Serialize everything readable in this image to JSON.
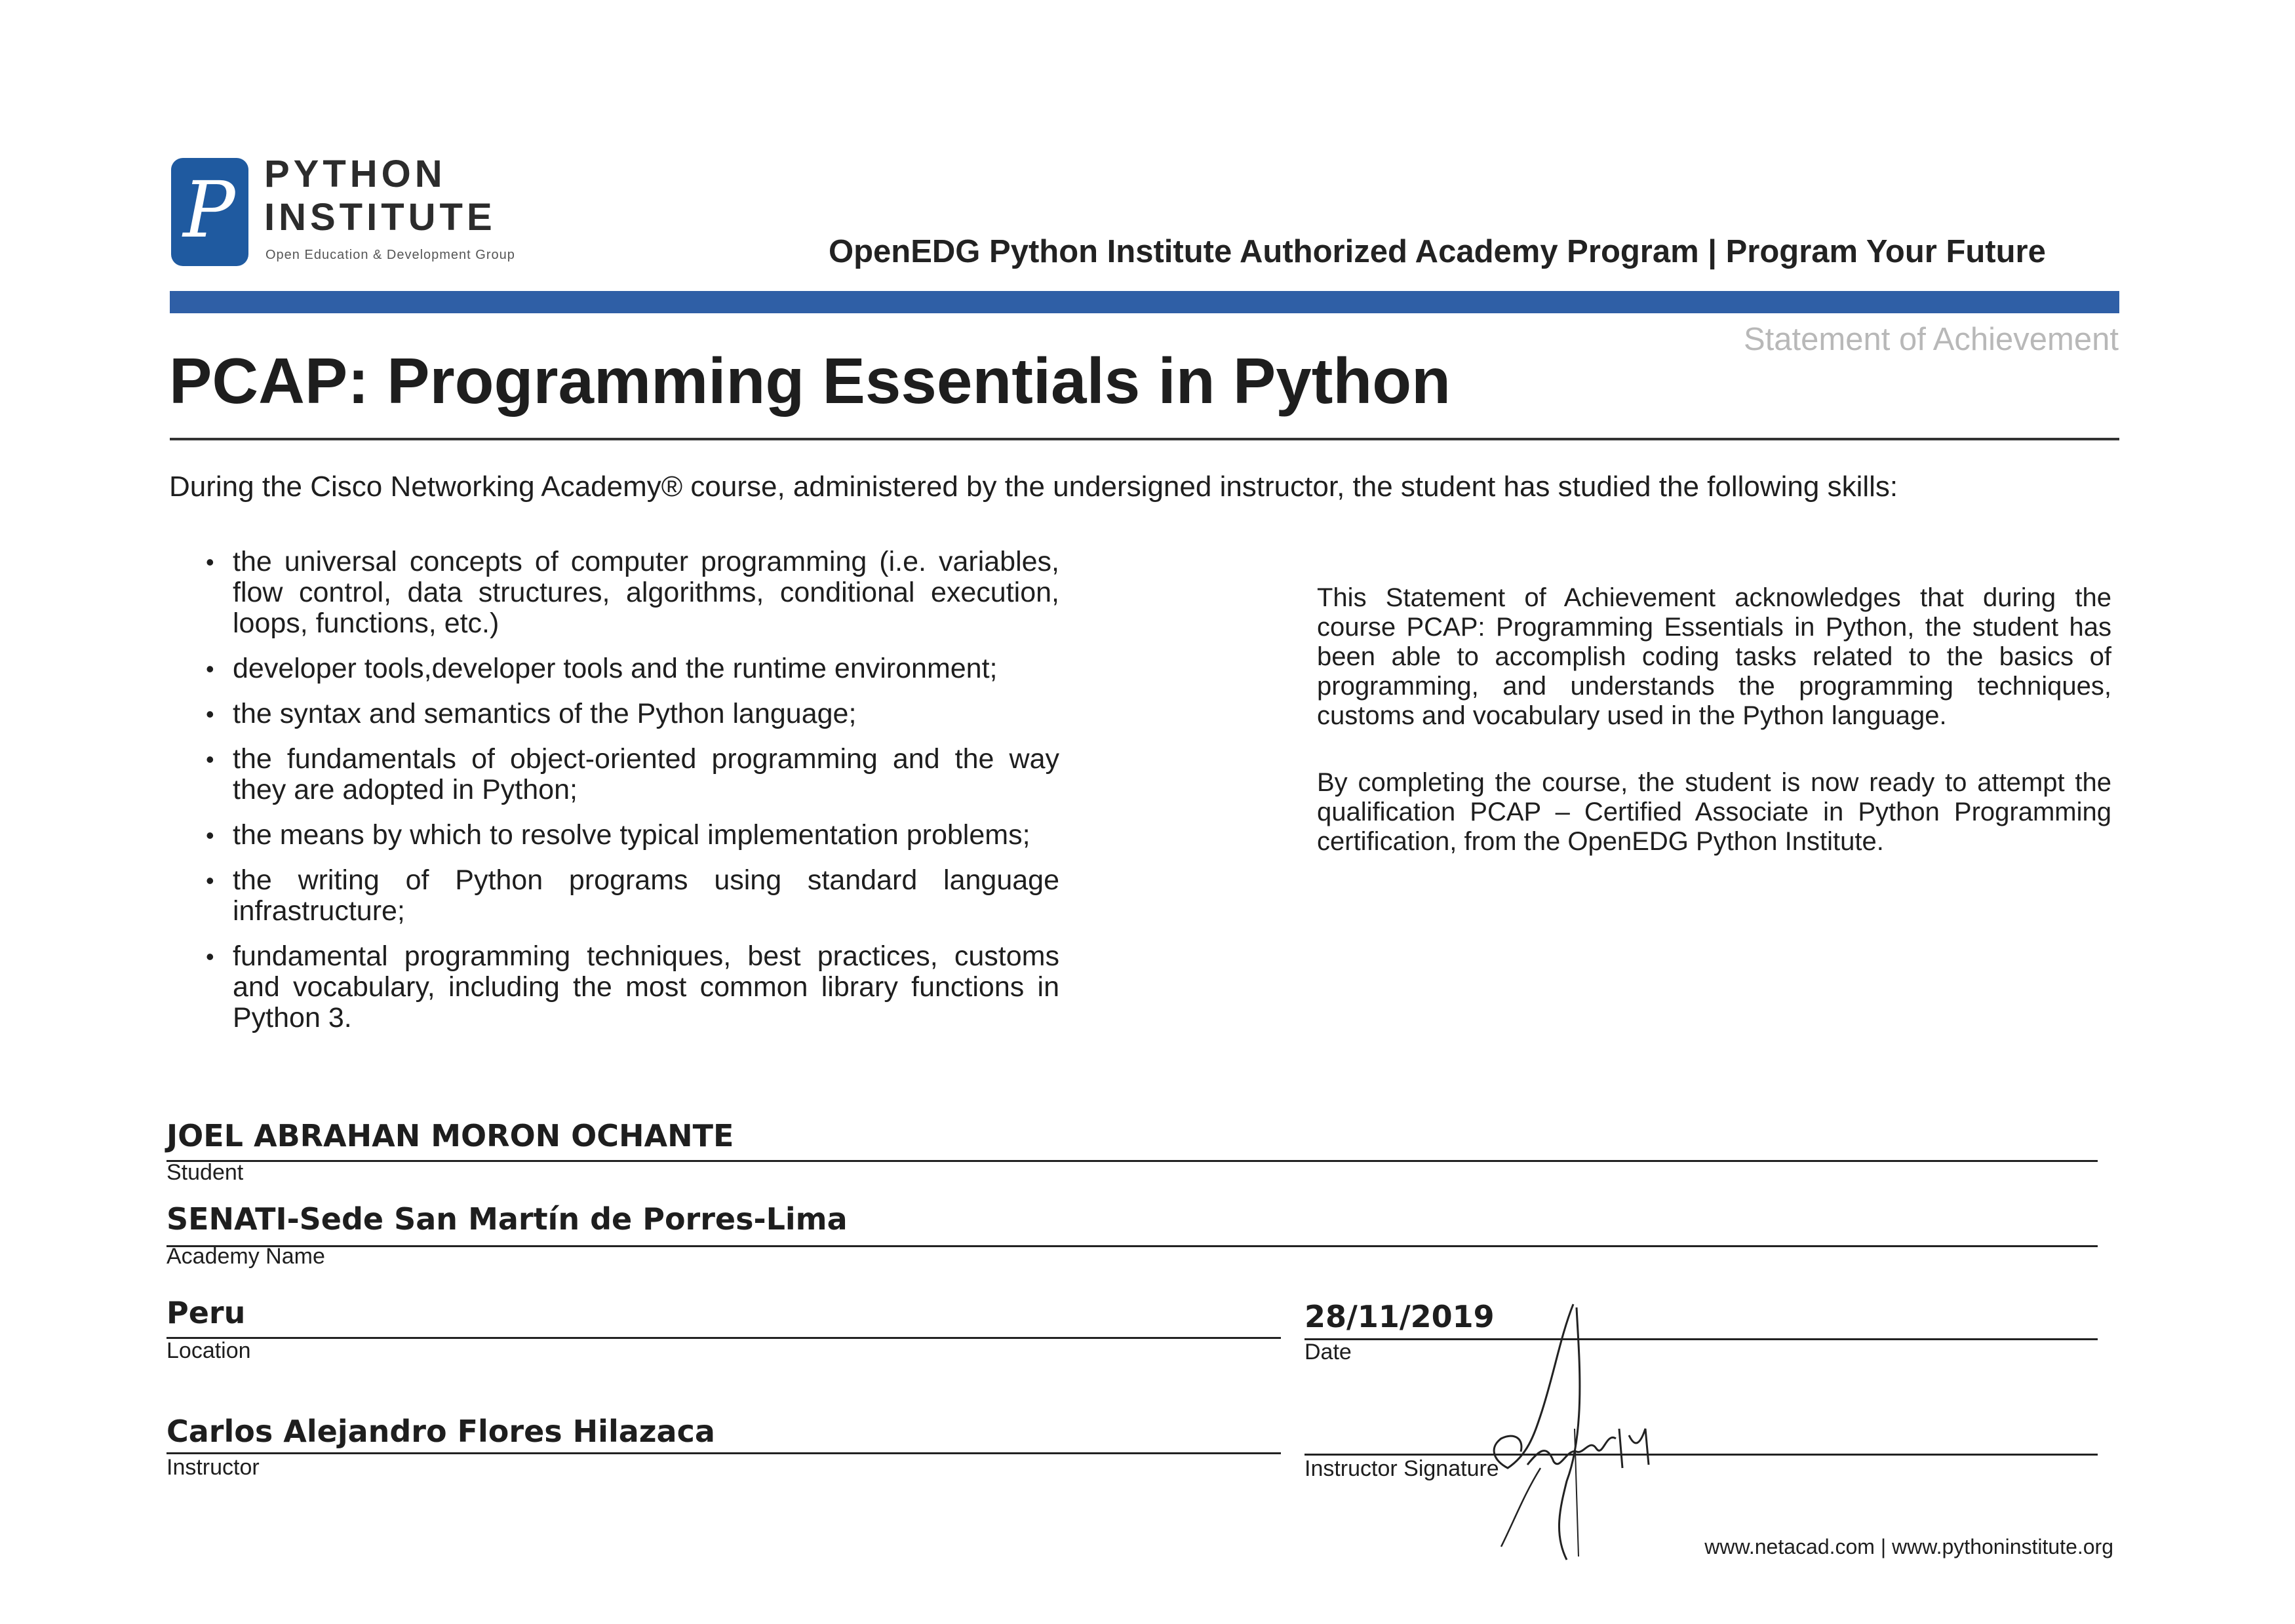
{
  "logo": {
    "name_line1": "PYTHON",
    "name_line2": "INSTITUTE",
    "tagline": "Open Education & Development Group",
    "icon": "python-institute-p-logo",
    "color": "#1f5aa0"
  },
  "program_line": "OpenEDG Python Institute Authorized Academy Program | Program Your Future",
  "statement_label": "Statement of Achievement",
  "course_title": "PCAP: Programming Essentials in Python",
  "intro": "During the Cisco Networking Academy® course, administered by the undersigned instructor, the student has studied the following skills:",
  "skills": [
    "the universal concepts of computer programming (i.e. variables, flow control, data structures, algorithms, conditional execution, loops, functions, etc.)",
    "developer tools,developer tools and the runtime environment;",
    "the syntax and semantics of the Python language;",
    "the fundamentals of object-oriented programming and the way they are adopted in Python;",
    "the means by which to resolve typical implementation problems;",
    "the writing of Python programs using standard language infrastructure;",
    "fundamental programming techniques, best practices, customs and vocabulary, including the most common library functions in Python 3."
  ],
  "achievement": {
    "paragraph1": "This Statement of Achievement acknowledges that during the course PCAP: Programming Essentials in Python, the student has been able to accomplish coding tasks related to the basics of programming, and understands the programming techniques, customs and vocabulary used in the Python language.",
    "paragraph2": "By completing the course, the student is now ready to attempt the qualification PCAP – Certified Associate in Python Programming certification, from the OpenEDG Python Institute."
  },
  "fields": {
    "student_name": "JOEL ABRAHAN MORON OCHANTE",
    "student_label": "Student",
    "academy_name": "SENATI-Sede San Martín de Porres-Lima",
    "academy_label": "Academy Name",
    "location": "Peru",
    "location_label": "Location",
    "date": "28/11/2019",
    "date_label": "Date",
    "instructor": "Carlos Alejandro Flores Hilazaca",
    "instructor_label": "Instructor",
    "signature_label": "Instructor Signature"
  },
  "footer": "www.netacad.com | www.pythoninstitute.org"
}
